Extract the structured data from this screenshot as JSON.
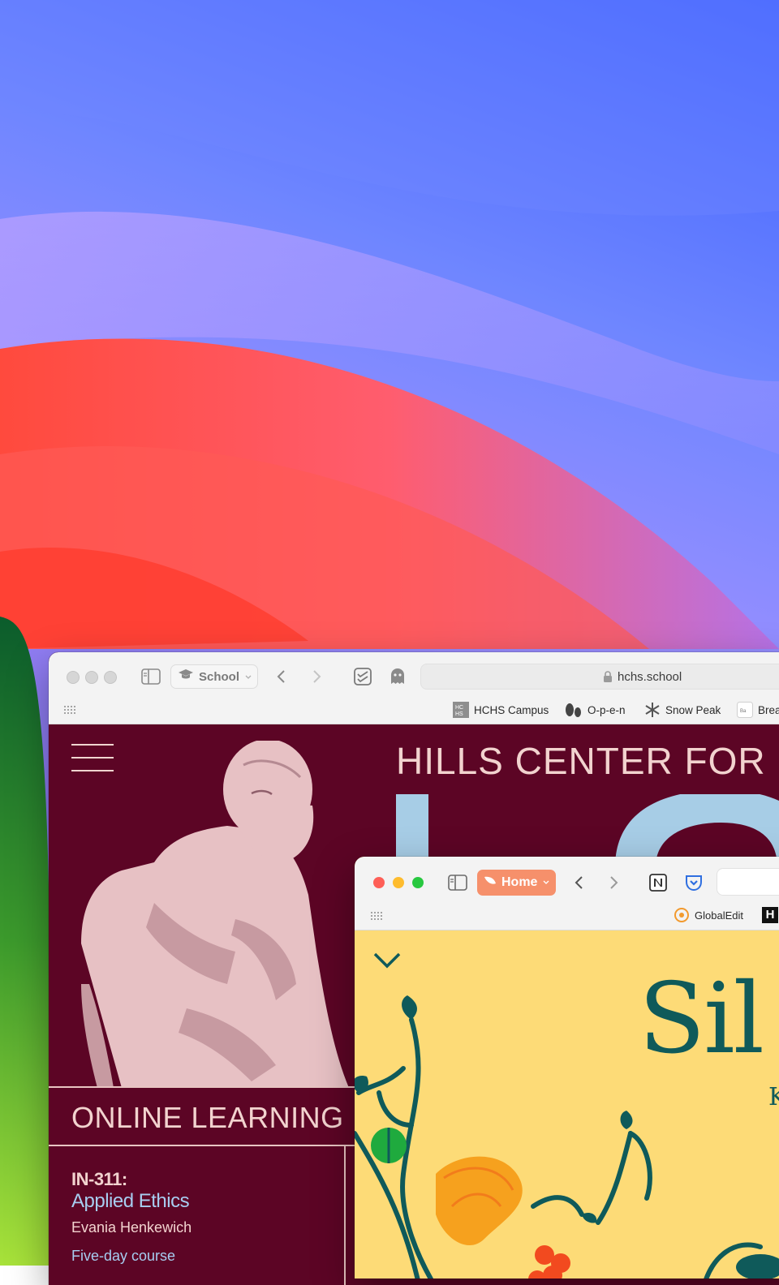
{
  "window1": {
    "tab_group_label": "School",
    "address": "hchs.school",
    "bookmarks": [
      "HCHS Campus",
      "O-p-e-n",
      "Snow Peak",
      "Brea"
    ],
    "page": {
      "site_title": "HILLS CENTER FOR",
      "section_title": "ONLINE LEARNING",
      "course_code": "IN-311:",
      "course_name": "Applied Ethics",
      "instructor": "Evania Henkewich",
      "duration": "Five-day course"
    }
  },
  "window2": {
    "tab_group_label": "Home",
    "bookmarks": [
      "GlobalEdit",
      "H"
    ],
    "page": {
      "title": "Sil",
      "subtitle": "K"
    }
  },
  "colors": {
    "hchs_maroon": "#5c0525",
    "hchs_text": "#f2d3cf",
    "hchs_accent_blue": "#a7cdf0",
    "home_yellow": "#fddb77",
    "home_teal": "#0f5a5a",
    "home_tab_orange": "#f6906b"
  },
  "icons": [
    "sidebar-icon",
    "graduation-cap-icon",
    "back-chevron-icon",
    "forward-chevron-icon",
    "checklist-icon",
    "ghost-icon",
    "lock-icon",
    "grid-icon",
    "hamburger-icon",
    "notion-icon",
    "pocket-icon",
    "chevron-down-icon"
  ]
}
